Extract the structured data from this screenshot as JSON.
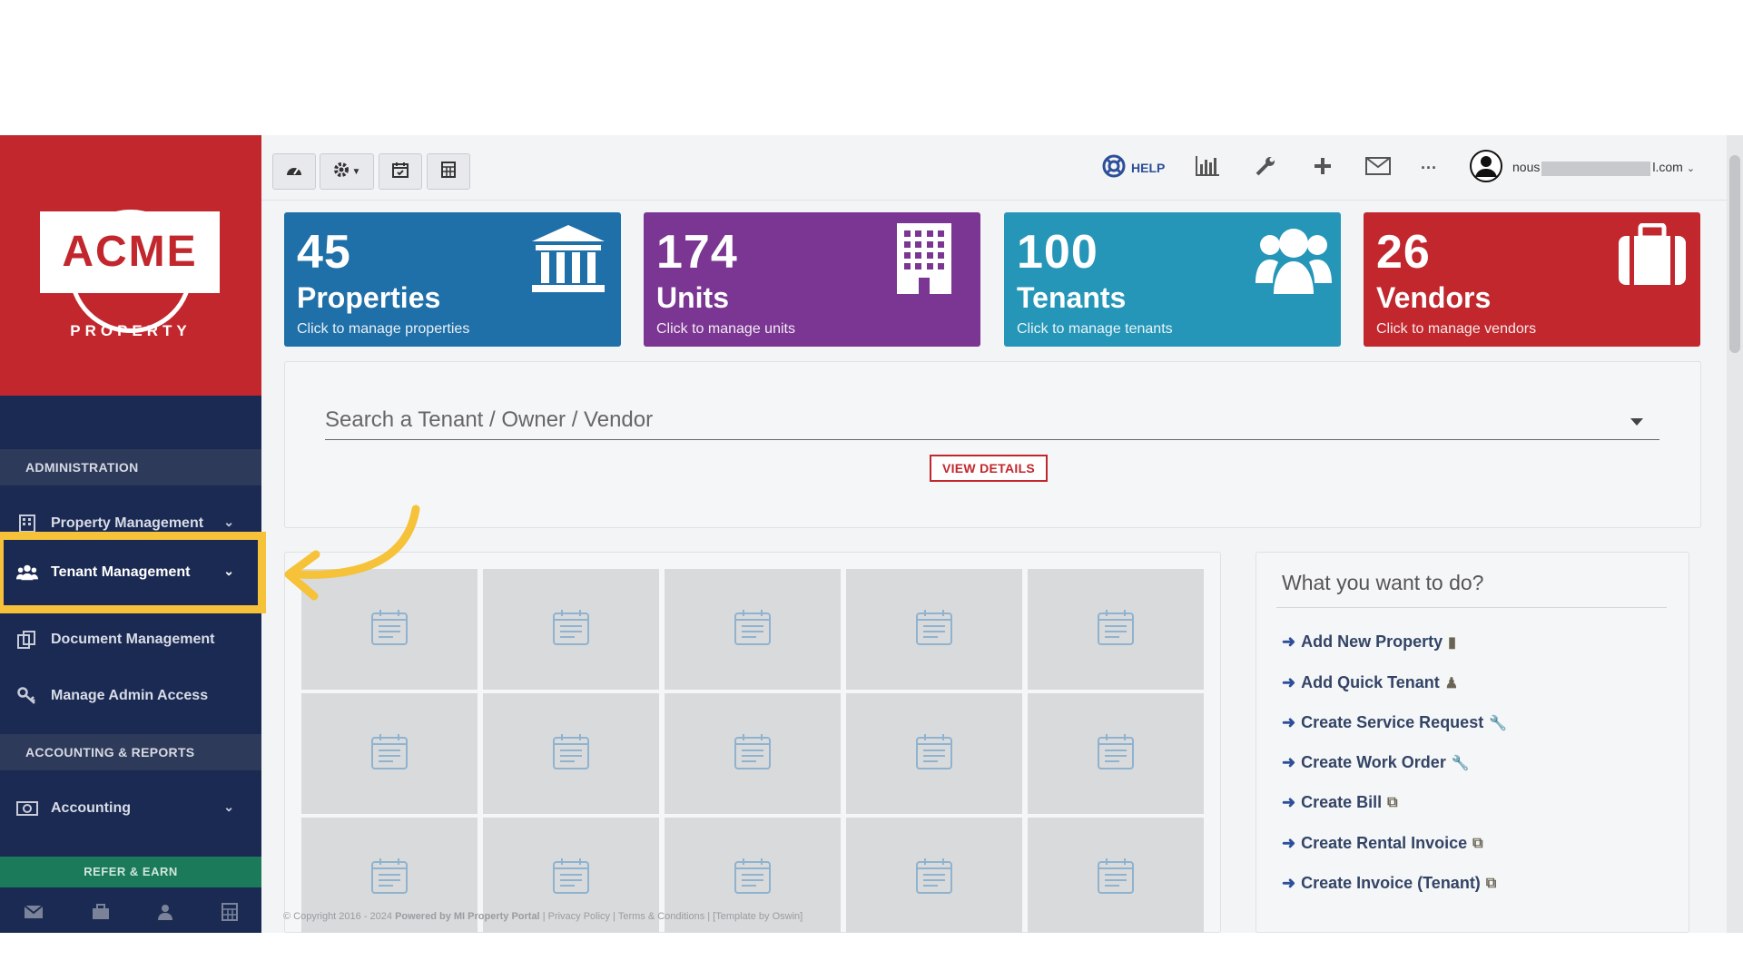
{
  "brand": {
    "name": "ACME",
    "tagline": "PROPERTY"
  },
  "sidebar": {
    "section_admin": "ADMINISTRATION",
    "section_accounting": "ACCOUNTING & REPORTS",
    "items": [
      {
        "label": "Property Management",
        "icon": "building-icon"
      },
      {
        "label": "Tenant Management",
        "icon": "users-icon"
      },
      {
        "label": "Document Management",
        "icon": "documents-icon"
      },
      {
        "label": "Manage Admin Access",
        "icon": "key-icon"
      },
      {
        "label": "Accounting",
        "icon": "money-icon"
      }
    ],
    "refer_label": "REFER & EARN"
  },
  "topbar": {
    "help_label": "HELP",
    "more_label": "···",
    "user_prefix": "nous",
    "user_suffix": "l.com"
  },
  "cards": [
    {
      "count": "45",
      "label": "Properties",
      "sub": "Click to manage properties",
      "color": "#1f6fa8"
    },
    {
      "count": "174",
      "label": "Units",
      "sub": "Click to manage units",
      "color": "#7b3592"
    },
    {
      "count": "100",
      "label": "Tenants",
      "sub": "Click to manage tenants",
      "color": "#2596b8"
    },
    {
      "count": "26",
      "label": "Vendors",
      "sub": "Click to manage vendors",
      "color": "#c1272d"
    }
  ],
  "search": {
    "placeholder": "Search a Tenant / Owner / Vendor",
    "button": "VIEW DETAILS"
  },
  "quick_actions": {
    "title": "What you want to do?",
    "items": [
      "Add New Property",
      "Add Quick Tenant",
      "Create Service Request",
      "Create Work Order",
      "Create Bill",
      "Create Rental Invoice",
      "Create Invoice (Tenant)"
    ]
  },
  "footer": {
    "copyright": "© Copyright 2016 - 2024",
    "powered": "Powered by MI Property Portal",
    "links": "| Privacy Policy | Terms & Conditions | [Template by Oswin]"
  }
}
